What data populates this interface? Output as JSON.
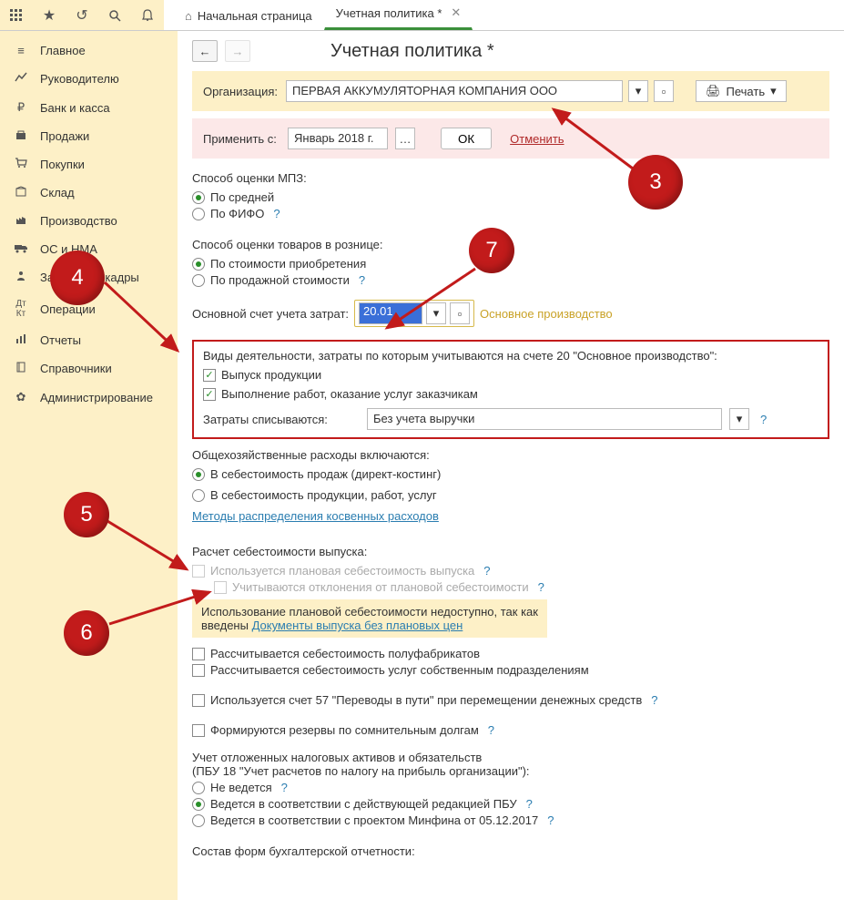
{
  "tabs": {
    "home": "Начальная страница",
    "active": "Учетная политика *"
  },
  "sidebar": [
    {
      "label": "Главное"
    },
    {
      "label": "Руководителю"
    },
    {
      "label": "Банк и касса"
    },
    {
      "label": "Продажи"
    },
    {
      "label": "Покупки"
    },
    {
      "label": "Склад"
    },
    {
      "label": "Производство"
    },
    {
      "label": "ОС и НМА"
    },
    {
      "label": "Зарплата и кадры"
    },
    {
      "label": "Операции"
    },
    {
      "label": "Отчеты"
    },
    {
      "label": "Справочники"
    },
    {
      "label": "Администрирование"
    }
  ],
  "page_title": "Учетная политика *",
  "org": {
    "label": "Организация:",
    "value": "ПЕРВАЯ АККУМУЛЯТОРНАЯ КОМПАНИЯ ООО"
  },
  "print_label": "Печать",
  "apply": {
    "label": "Применить с:",
    "date": "Январь 2018 г.",
    "ok": "ОК",
    "cancel": "Отменить"
  },
  "mpz": {
    "label": "Способ оценки МПЗ:",
    "opt1": "По средней",
    "opt2": "По ФИФО"
  },
  "retail": {
    "label": "Способ оценки товаров в рознице:",
    "opt1": "По стоимости приобретения",
    "opt2": "По продажной стоимости"
  },
  "account": {
    "label": "Основной счет учета затрат:",
    "value": "20.01",
    "desc": "Основное производство"
  },
  "activities": {
    "label": "Виды деятельности, затраты по которым учитываются на счете 20 \"Основное производство\":",
    "c1": "Выпуск продукции",
    "c2": "Выполнение работ, оказание услуг заказчикам",
    "combo_label": "Затраты списываются:",
    "combo_value": "Без учета выручки"
  },
  "overhead": {
    "label": "Общехозяйственные расходы включаются:",
    "opt1": "В себестоимость продаж (директ-костинг)",
    "opt2": "В  себестоимость продукции, работ, услуг",
    "link": "Методы распределения косвенных расходов"
  },
  "cost_calc": {
    "label": "Расчет себестоимости выпуска:",
    "c1": "Используется плановая себестоимость выпуска",
    "c2": "Учитываются отклонения от плановой себестоимости",
    "warn1": "Использование плановой себестоимости недоступно, так как введены ",
    "warn_link": "Документы выпуска без плановых цен",
    "c3": "Рассчитывается себестоимость полуфабрикатов",
    "c4": "Рассчитывается себестоимость услуг собственным подразделениям"
  },
  "c57": "Используется счет 57 \"Переводы в пути\" при перемещении денежных средств",
  "reserves": "Формируются резервы по сомнительным долгам",
  "deferred": {
    "label1": "Учет отложенных налоговых активов и обязательств",
    "label2": "(ПБУ 18 \"Учет расчетов по налогу на прибыль организации\"):",
    "opt1": "Не ведется",
    "opt2": "Ведется в соответствии с действующей редакцией ПБУ",
    "opt3": "Ведется в соответствии с проектом Минфина от 05.12.2017"
  },
  "forms_label": "Состав форм бухгалтерской отчетности:",
  "bubbles": {
    "b3": "3",
    "b4": "4",
    "b5": "5",
    "b6": "6",
    "b7": "7"
  }
}
